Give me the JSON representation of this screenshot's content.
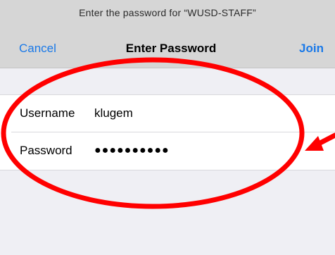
{
  "header": {
    "prompt": "Enter the password for “WUSD-STAFF”",
    "cancel_label": "Cancel",
    "title": "Enter Password",
    "join_label": "Join"
  },
  "form": {
    "username_label": "Username",
    "username_value": "klugem",
    "password_label": "Password",
    "password_value": "●●●●●●●●●●"
  },
  "colors": {
    "accent": "#1a79e8",
    "annotation": "#ff0000",
    "header_bg": "#d6d6d6",
    "page_bg": "#efeff4"
  },
  "annotation": {
    "shapes": [
      "ellipse-highlight",
      "arrow-icon"
    ]
  }
}
